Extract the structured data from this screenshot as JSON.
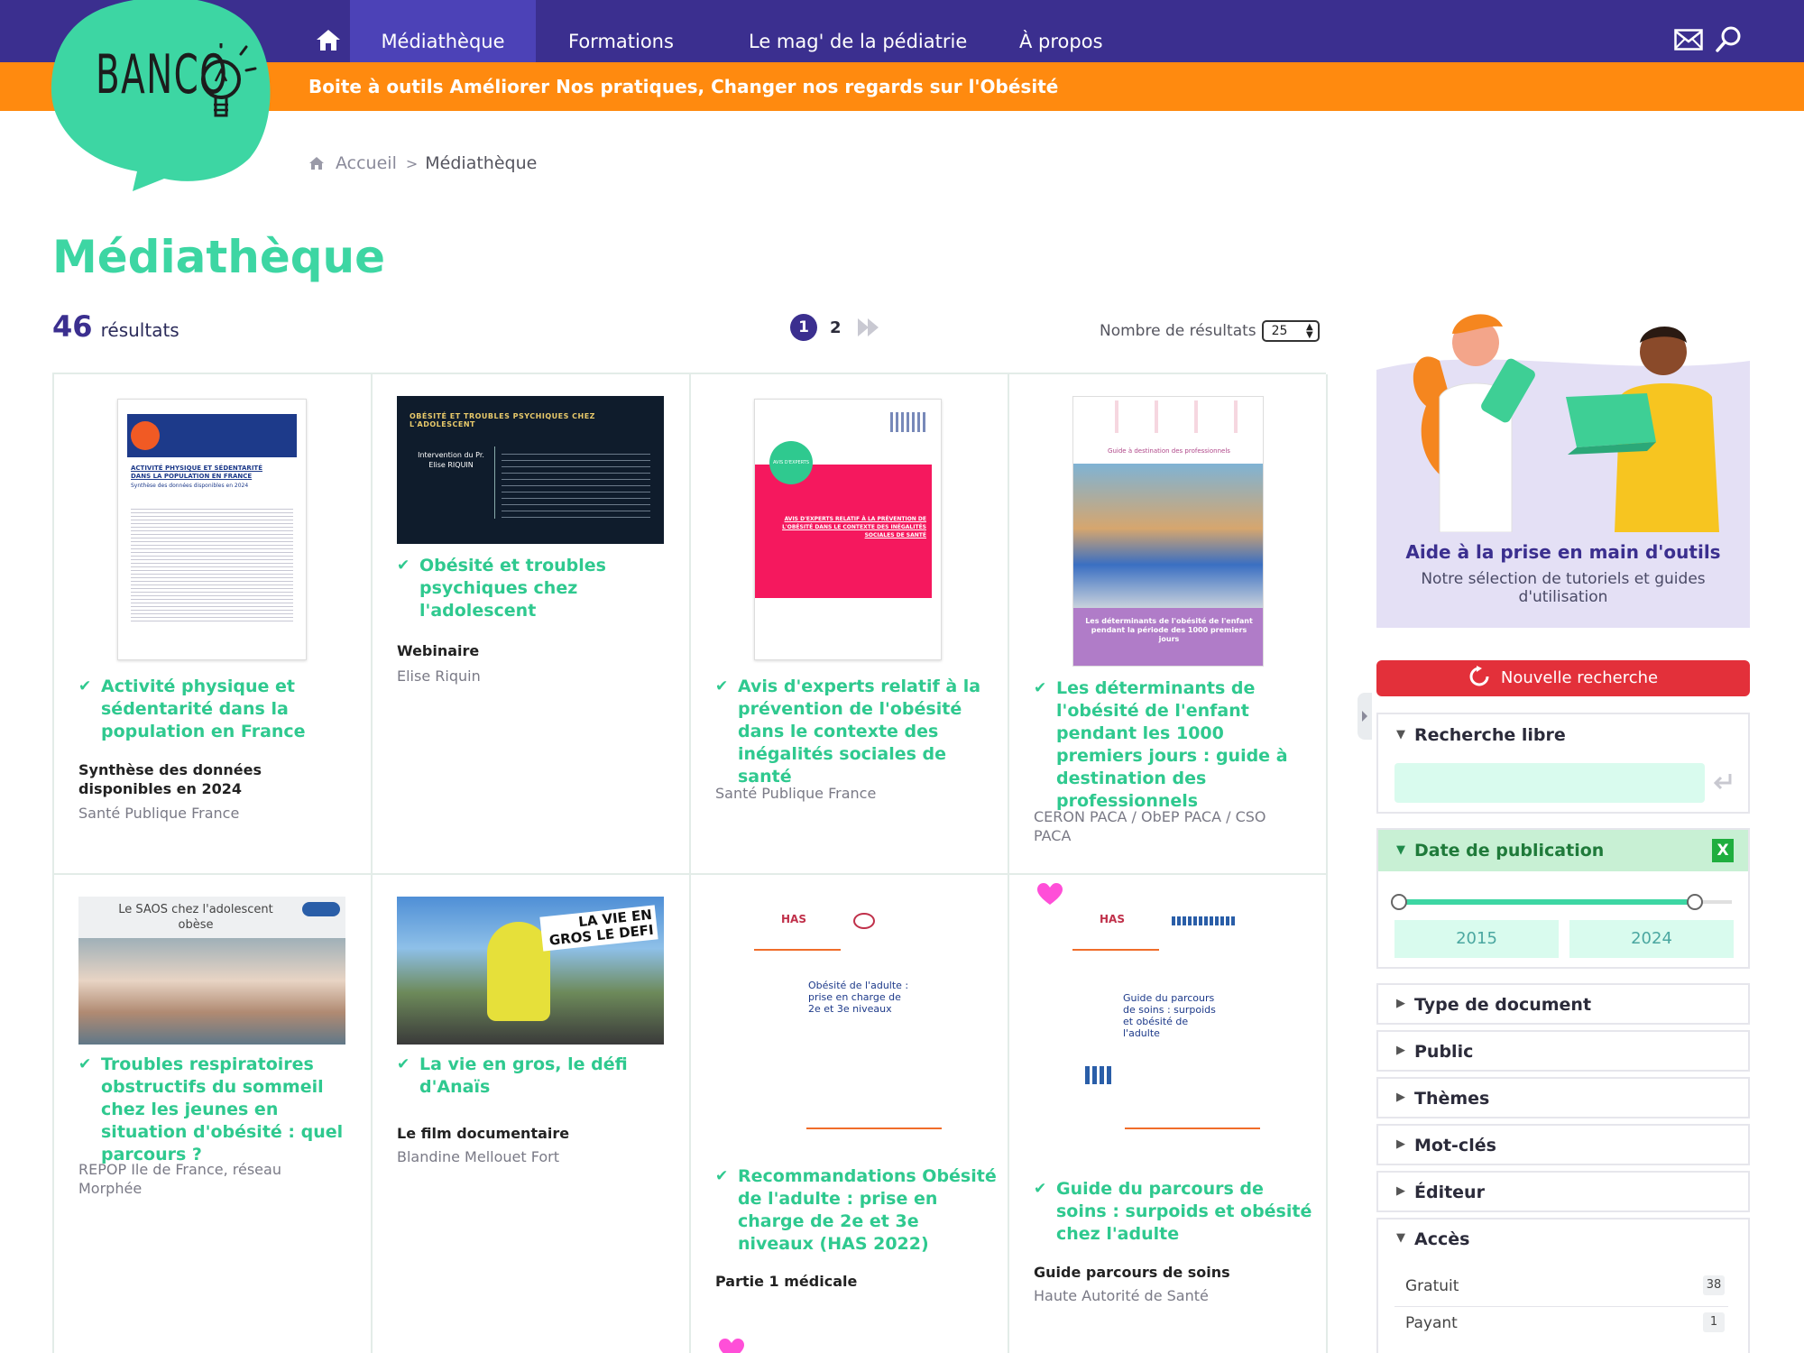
{
  "header": {
    "brand": "BANCO",
    "nav": {
      "mediatheque": "Médiathèque",
      "formations": "Formations",
      "mag": "Le mag' de la pédiatrie",
      "apropos": "À propos"
    },
    "tagline": "Boite à outils Améliorer Nos pratiques, Changer nos regards sur l'Obésité",
    "icons": [
      "home-icon",
      "mail-icon",
      "search-icon"
    ]
  },
  "breadcrumb": {
    "home": "Accueil",
    "sep": ">",
    "current": "Médiathèque"
  },
  "page_title": "Médiathèque",
  "results": {
    "count": "46",
    "label": "résultats",
    "pages": [
      "1",
      "2"
    ],
    "current_page": "1",
    "per_page_label": "Nombre de résultats",
    "per_page_value": "25"
  },
  "cards": [
    {
      "title": "Activité physique et sédentarité dans la population en France",
      "subtitle": "Synthèse des données disponibles en 2024",
      "publisher": "Santé Publique France",
      "thumb_title": "ACTIVITÉ PHYSIQUE ET SÉDENTARITÉ DANS LA POPULATION EN FRANCE",
      "thumb_sub": "Synthèse des données disponibles en 2024"
    },
    {
      "title": "Obésité et troubles psychiques chez l'adolescent",
      "subtitle": "Webinaire",
      "publisher": "Elise Riquin",
      "thumb_title": "OBÉSITÉ ET TROUBLES PSYCHIQUES CHEZ L'ADOLESCENT",
      "thumb_sub": "Intervention du Pr. Elise RIQUIN"
    },
    {
      "title": "Avis d'experts relatif à la prévention de l'obésité dans le contexte des inégalités sociales de santé",
      "subtitle": "",
      "publisher": "Santé Publique France",
      "thumb_badge": "AVIS D'EXPERTS",
      "thumb_title": "AVIS D'EXPERTS RELATIF À LA PRÉVENTION DE L'OBÉSITÉ DANS LE CONTEXTE DES INÉGALITÉS SOCIALES DE SANTÉ"
    },
    {
      "title": "Les déterminants de l'obésité de l'enfant pendant les 1000 premiers jours : guide à destination des professionnels",
      "subtitle": "",
      "publisher": "CERON PACA / ObEP PACA / CSO PACA",
      "thumb_title": "Guide à destination des professionnels",
      "thumb_sub": "Les déterminants de l'obésité de l'enfant pendant la période des 1000 premiers jours"
    },
    {
      "title": "Troubles respiratoires obstructifs du sommeil chez les jeunes en situation d'obésité : quel parcours ?",
      "subtitle": "",
      "publisher": "REPOP Ile de France, réseau Morphée",
      "thumb_title": "Le SAOS chez l'adolescent obèse"
    },
    {
      "title": "La vie en gros, le défi d'Anaïs",
      "subtitle": "Le film documentaire",
      "publisher": "Blandine Mellouet Fort",
      "thumb_title": "LA VIE EN GROS LE DEFI"
    },
    {
      "title": "Recommandations Obésité de l'adulte : prise en charge de 2e et 3e niveaux (HAS 2022)",
      "subtitle": "Partie 1 médicale",
      "publisher": "",
      "thumb_title": "Obésité de l'adulte : prise en charge de 2e et 3e niveaux"
    },
    {
      "title": "Guide du parcours de soins : surpoids et obésité chez l'adulte",
      "subtitle": "Guide parcours de soins",
      "publisher": "Haute Autorité de Santé",
      "thumb_title": "Guide du parcours de soins : surpoids et obésité de l'adulte"
    }
  ],
  "sidebar": {
    "promo_title": "Aide à la prise en main d'outils",
    "promo_desc": "Notre sélection de tutoriels et guides d'utilisation",
    "new_search": "Nouvelle recherche",
    "free_search": {
      "label": "Recherche libre",
      "placeholder": ""
    },
    "date": {
      "label": "Date de publication",
      "clear": "X",
      "from": "2015",
      "to": "2024"
    },
    "facets": [
      "Type de document",
      "Public",
      "Thèmes",
      "Mot-clés",
      "Éditeur"
    ],
    "access": {
      "label": "Accès",
      "options": [
        {
          "label": "Gratuit",
          "count": "38"
        },
        {
          "label": "Payant",
          "count": "1"
        }
      ]
    }
  },
  "colors": {
    "primary": "#3b2f8f",
    "nav_active": "#4c42b7",
    "orange": "#ff8a0f",
    "accent_green": "#3dd6a3",
    "title_green": "#2fc98f",
    "danger": "#e3303a",
    "favorite": "#ff4fd8"
  }
}
